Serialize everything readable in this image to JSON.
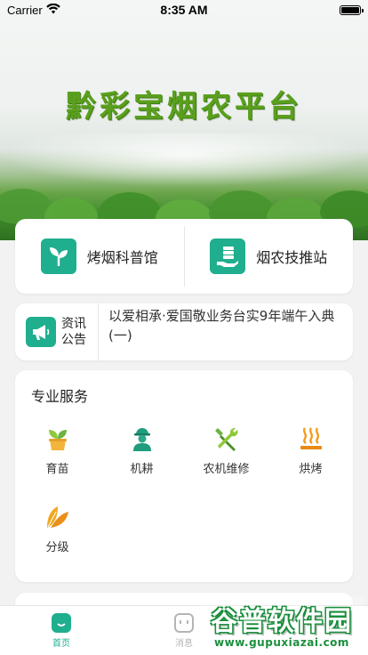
{
  "status_bar": {
    "carrier": "Carrier",
    "time": "8:35 AM"
  },
  "banner": {
    "title": "黔彩宝烟农平台"
  },
  "entries": [
    {
      "label": "烤烟科普馆",
      "icon": "plant-sprout-icon"
    },
    {
      "label": "烟农技推站",
      "icon": "hand-stack-icon"
    }
  ],
  "notice": {
    "title": "资讯公告",
    "icon": "megaphone-icon",
    "text": "以爱相承·爱国敬业务台实9年端午入典(一)"
  },
  "services": {
    "title": "专业服务",
    "items": [
      {
        "label": "育苗",
        "icon": "seedling-pot-icon"
      },
      {
        "label": "机耕",
        "icon": "worker-icon"
      },
      {
        "label": "农机维修",
        "icon": "tools-icon"
      },
      {
        "label": "烘烤",
        "icon": "heat-icon"
      },
      {
        "label": "分级",
        "icon": "leaves-icon"
      }
    ]
  },
  "tabbar": {
    "items": [
      {
        "label": "首页",
        "icon": "home-icon",
        "active": true
      },
      {
        "label": "消息",
        "icon": "message-icon",
        "active": false
      }
    ]
  },
  "watermark": {
    "main": "谷普软件园",
    "url": "www.gupuxiazai.com"
  },
  "colors": {
    "accent": "#1fae8e",
    "banner_title": "#5aa01e",
    "tab_active": "#1fae8e",
    "tab_inactive": "#b5b5b5"
  }
}
